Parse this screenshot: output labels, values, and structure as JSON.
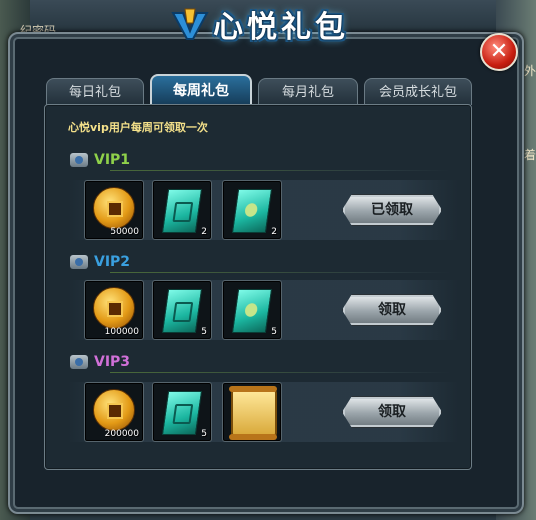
{
  "background": {
    "left_label": "纪密码",
    "right_label_1": "君者外",
    "right_label_2": "宝着"
  },
  "window": {
    "title": "心悦礼包",
    "close_label": "✕"
  },
  "tabs": [
    {
      "label": "每日礼包",
      "active": false
    },
    {
      "label": "每周礼包",
      "active": true
    },
    {
      "label": "每月礼包",
      "active": false
    },
    {
      "label": "会员成长礼包",
      "active": false
    }
  ],
  "notice": "心悦vip用户每周可领取一次",
  "sections": [
    {
      "label": "VIP1",
      "color": "#8fd14a",
      "items": [
        {
          "icon": "gold-coin-icon",
          "quantity": "50000"
        },
        {
          "icon": "card-icon",
          "quantity": "2"
        },
        {
          "icon": "leaf-card-icon",
          "quantity": "2"
        }
      ],
      "button": "已领取"
    },
    {
      "label": "VIP2",
      "color": "#3aa0e0",
      "items": [
        {
          "icon": "gold-coin-icon",
          "quantity": "100000"
        },
        {
          "icon": "card-icon",
          "quantity": "5"
        },
        {
          "icon": "leaf-card-icon",
          "quantity": "5"
        }
      ],
      "button": "领取"
    },
    {
      "label": "VIP3",
      "color": "#d070d8",
      "items": [
        {
          "icon": "gold-coin-icon",
          "quantity": "200000"
        },
        {
          "icon": "card-icon",
          "quantity": "5"
        },
        {
          "icon": "scroll-icon",
          "quantity": ""
        }
      ],
      "button": "领取"
    }
  ]
}
